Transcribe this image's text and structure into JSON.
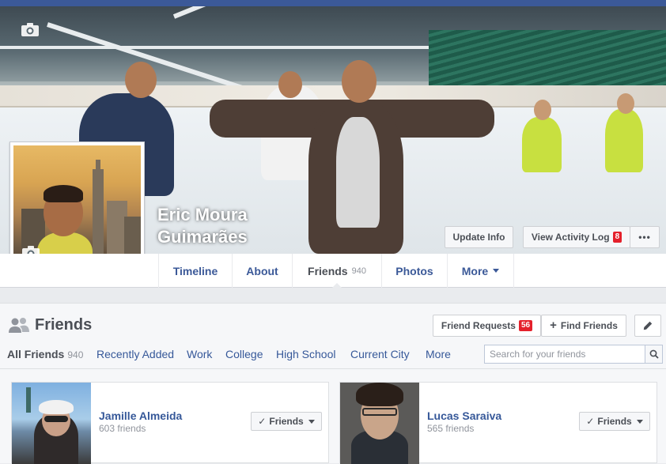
{
  "colors": {
    "brand": "#3b5998",
    "link": "#365899",
    "badge": "#e4202b"
  },
  "profile": {
    "name_line1": "Eric Moura",
    "name_line2": "Guimarães"
  },
  "cover_actions": {
    "update_info": "Update Info",
    "activity_log": "View Activity Log",
    "activity_log_badge": "8",
    "more_dots": "•••"
  },
  "nav": {
    "tabs": [
      {
        "label": "Timeline"
      },
      {
        "label": "About"
      },
      {
        "label": "Friends",
        "count": "940"
      },
      {
        "label": "Photos"
      },
      {
        "label": "More"
      }
    ]
  },
  "friends": {
    "title": "Friends",
    "requests_label": "Friend Requests",
    "requests_badge": "56",
    "find_label": "Find Friends",
    "filters": [
      {
        "label": "All Friends",
        "count": "940"
      },
      {
        "label": "Recently Added"
      },
      {
        "label": "Work"
      },
      {
        "label": "College"
      },
      {
        "label": "High School"
      },
      {
        "label": "Current City"
      },
      {
        "label": "More"
      }
    ],
    "search_placeholder": "Search for your friends",
    "cards": [
      {
        "name": "Jamille Almeida",
        "count": "603 friends",
        "button": "Friends"
      },
      {
        "name": "Lucas Saraiva",
        "count": "565 friends",
        "button": "Friends"
      }
    ]
  }
}
